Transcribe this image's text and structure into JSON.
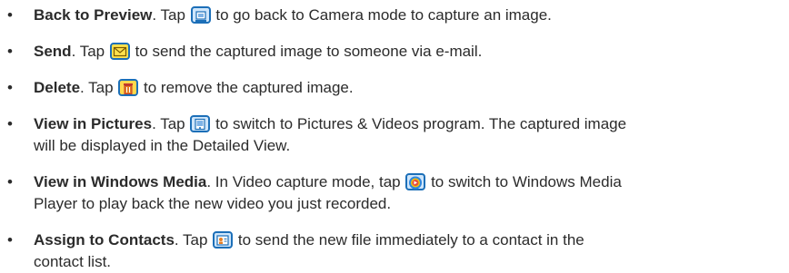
{
  "items": [
    {
      "term": "Back to Preview",
      "before": ". Tap ",
      "icon": "camera-preview-icon",
      "after": " to go back to Camera mode to capture an image."
    },
    {
      "term": "Send",
      "before": ". Tap ",
      "icon": "email-envelope-icon",
      "after": " to send the captured image to someone via e-mail."
    },
    {
      "term": "Delete",
      "before": ". Tap ",
      "icon": "trash-can-icon",
      "after": " to remove the captured image."
    },
    {
      "term": "View in Pictures",
      "before": ". Tap ",
      "icon": "pictures-program-icon",
      "after": " to switch to Pictures & Videos program. The captured image",
      "line2": "will be displayed in the Detailed View."
    },
    {
      "term": "View in Windows Media",
      "before": ". In Video capture mode, tap ",
      "icon": "windows-media-player-icon",
      "after": " to switch to Windows Media",
      "line2": "Player to play back the new video you just recorded."
    },
    {
      "term": "Assign to Contacts",
      "before": ". Tap ",
      "icon": "contact-card-icon",
      "after": " to send the new file immediately to a contact in the",
      "line2": "contact list."
    }
  ],
  "bullet_glyph": "•",
  "colors": {
    "text": "#2b2b2b",
    "icon_border": "#1c6fb8",
    "icon_fill": "#cfe6fb"
  }
}
